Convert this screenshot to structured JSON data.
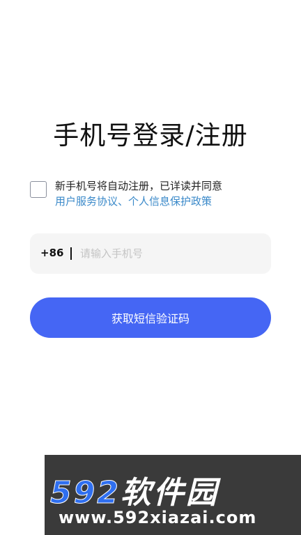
{
  "login": {
    "title": "手机号登录/注册",
    "agreement_text": "新手机号将自动注册，已详读并同意",
    "agreement_link": "用户服务协议、个人信息保护政策",
    "country_code": "+86",
    "phone_placeholder": "请输入手机号",
    "phone_value": "",
    "sms_button_label": "获取短信验证码"
  },
  "watermark": {
    "logo_number": "592",
    "logo_text": "软件园",
    "url": "www.592xiazai.com"
  },
  "colors": {
    "primary_button": "#4566f4",
    "link": "#3a89c9",
    "input_background": "#f5f5f5"
  }
}
